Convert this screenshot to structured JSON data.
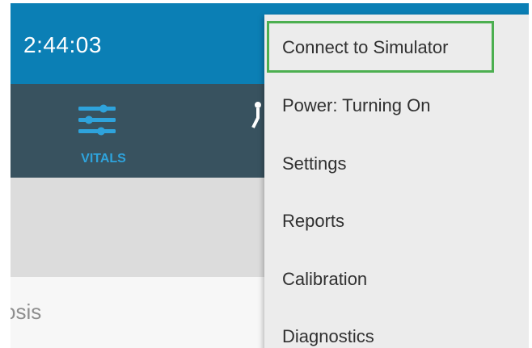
{
  "header": {
    "time": "2:44:03"
  },
  "nav": {
    "items": [
      {
        "label": "VITALS",
        "icon": "sliders-icon"
      },
      {
        "label": "",
        "icon": "partial-nav-icon"
      }
    ]
  },
  "content": {
    "partial_text": "osis"
  },
  "menu": {
    "items": [
      {
        "label": "Connect to Simulator",
        "highlighted": true
      },
      {
        "label": "Power: Turning On"
      },
      {
        "label": "Settings"
      },
      {
        "label": "Reports"
      },
      {
        "label": "Calibration"
      },
      {
        "label": "Diagnostics"
      }
    ]
  },
  "colors": {
    "header_blue": "#0b7fb5",
    "nav_dark": "#38525f",
    "nav_accent": "#2ea3dc",
    "highlight_green": "#4caf50"
  }
}
